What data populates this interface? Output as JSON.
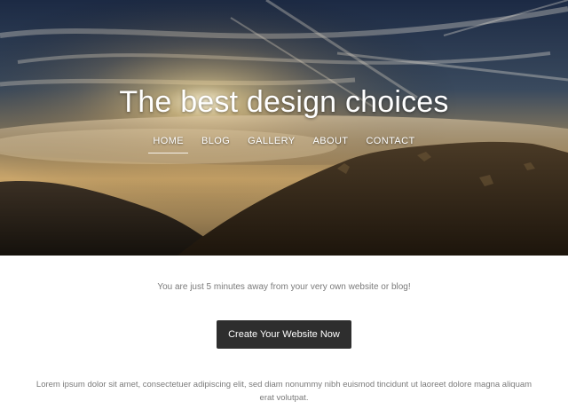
{
  "hero": {
    "title": "The best design choices"
  },
  "nav": {
    "items": [
      {
        "label": "HOME",
        "active": true
      },
      {
        "label": "BLOG",
        "active": false
      },
      {
        "label": "GALLERY",
        "active": false
      },
      {
        "label": "ABOUT",
        "active": false
      },
      {
        "label": "CONTACT",
        "active": false
      }
    ]
  },
  "main": {
    "tagline": "You are just 5 minutes away from your very own website or blog!",
    "cta_label": "Create Your Website Now",
    "lorem": "Lorem ipsum dolor sit amet, consectetuer adipiscing elit, sed diam nonummy nibh euismod tincidunt ut laoreet dolore magna aliquam erat volutpat."
  },
  "colors": {
    "button_bg": "#2e2e2e",
    "body_text": "#7a7a7a",
    "hero_text": "#ffffff"
  }
}
